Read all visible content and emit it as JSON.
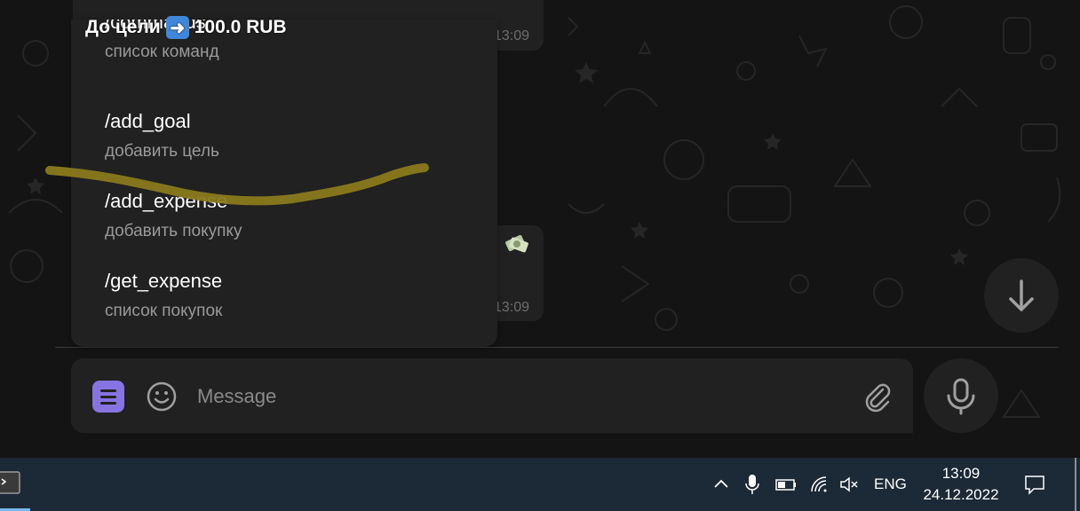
{
  "goal_header": {
    "prefix": "До цели",
    "arrow_icon": "right-arrow-emoji-icon",
    "amount": "100.0 RUB"
  },
  "messages": [
    {
      "time": "13:09"
    },
    {
      "time": "13:09",
      "sticker_icon": "money-emoji-icon"
    }
  ],
  "commands": [
    {
      "name": "/commands",
      "description": "список команд"
    },
    {
      "name": "/add_goal",
      "description": "добавить цель"
    },
    {
      "name": "/add_expense",
      "description": "добавить покупку"
    },
    {
      "name": "/get_expense",
      "description": "список покупок"
    }
  ],
  "composer": {
    "placeholder": "Message"
  },
  "taskbar": {
    "language": "ENG",
    "time": "13:09",
    "date": "24.12.2022"
  },
  "colors": {
    "accent": "#8774e1",
    "scribble": "#8a7a1e",
    "taskbar": "#1c2936",
    "panel": "#212121"
  }
}
